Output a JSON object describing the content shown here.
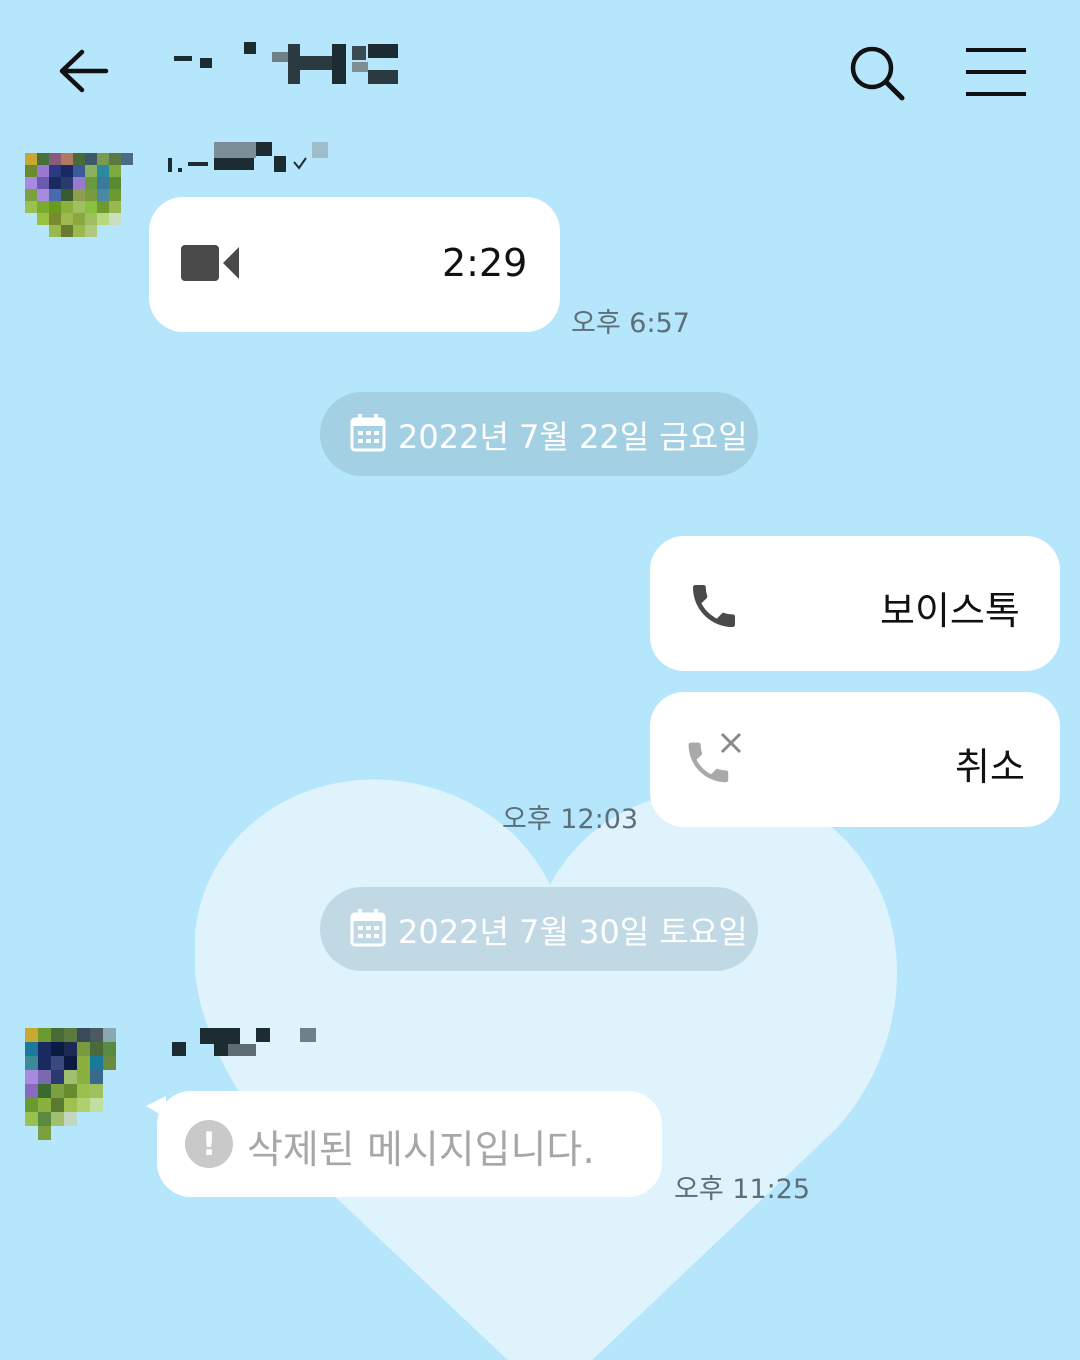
{
  "header": {
    "back_icon": "arrow-left-icon",
    "title_obscured": true,
    "search_icon": "search-icon",
    "menu_icon": "hamburger-menu-icon"
  },
  "messages": [
    {
      "side": "received",
      "type": "video_call",
      "icon": "video-camera-icon",
      "duration": "2:29",
      "time": "오후 6:57"
    },
    {
      "type": "date_divider",
      "icon": "calendar-icon",
      "label": "2022년 7월 22일 금요일"
    },
    {
      "side": "sent",
      "type": "voice_call",
      "icon": "phone-icon",
      "label": "보이스톡"
    },
    {
      "side": "sent",
      "type": "voice_call_cancelled",
      "icon": "phone-cancelled-icon",
      "label": "취소",
      "time": "오후 12:03"
    },
    {
      "type": "date_divider",
      "icon": "calendar-icon",
      "label": "2022년 7월 30일 토요일"
    },
    {
      "side": "received",
      "type": "deleted",
      "icon": "exclamation-icon",
      "label": "삭제된 메시지입니다.",
      "time": "오후 11:25"
    }
  ],
  "colors": {
    "background": "#b6e6fb",
    "bubble": "#ffffff",
    "time_text": "#5c6f78",
    "date_chip_text": "#ffffff",
    "deleted_text": "#a7a7a7"
  }
}
